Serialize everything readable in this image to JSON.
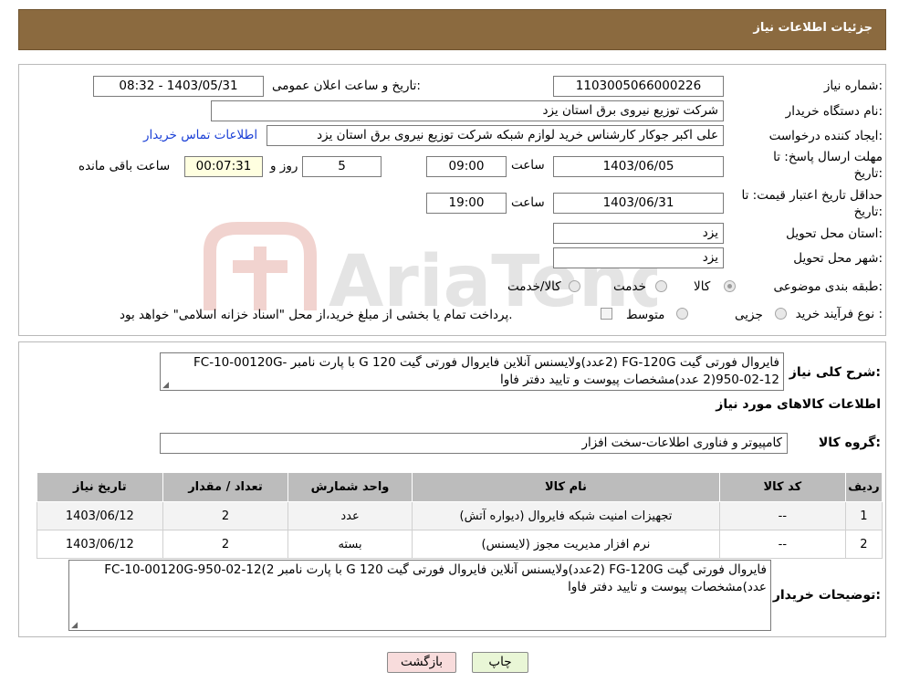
{
  "header": {
    "title": "جزئیات اطلاعات نیاز"
  },
  "form": {
    "need_number_label": "شماره نیاز:",
    "need_number": "1103005066000226",
    "announce_label": "تاریخ و ساعت اعلان عمومی:",
    "announce_value": "1403/05/31 - 08:32",
    "buyer_org_label": "نام دستگاه خریدار:",
    "buyer_org": "شرکت توزیع نیروی برق استان یزد",
    "requester_label": "ایجاد کننده درخواست:",
    "requester": "علی اکبر  جوکار  کارشناس خرید لوازم شبکه   شرکت توزیع نیروی برق استان یزد",
    "contact_link": "اطلاعات تماس خریدار",
    "deadline_label_1": "مهلت ارسال پاسخ: تا",
    "deadline_label_2": "تاریخ:",
    "deadline_date": "1403/06/05",
    "time_label": "ساعت",
    "deadline_time": "09:00",
    "days_value": "5",
    "days_label": "روز و",
    "remaining_time": "00:07:31",
    "remaining_label": "ساعت باقی مانده",
    "validity_label_1": "حداقل تاریخ اعتبار قیمت: تا",
    "validity_label_2": "تاریخ:",
    "validity_date": "1403/06/31",
    "validity_time": "19:00",
    "province_label": "استان محل تحویل:",
    "province": "یزد",
    "city_label": "شهر محل تحویل:",
    "city": "یزد",
    "category_label": "طبقه بندی موضوعی:",
    "category_options": [
      "کالا",
      "خدمت",
      "کالا/خدمت"
    ],
    "process_label": "نوع فرآیند خرید :",
    "process_options": [
      "جزیی",
      "متوسط"
    ],
    "payment_note": "پرداخت تمام یا بخشی از مبلغ خرید،از محل \"اسناد خزانه اسلامی\" خواهد بود."
  },
  "details": {
    "summary_label": "شرح کلی نیاز:",
    "summary_line1": "فایروال فورتی گیت FG-120G (2عدد)ولایسنس آنلاین فایروال فورتی گیت G 120 با پارت نامبر -FC-10-00120G",
    "summary_line2": "950-02-12(2 عدد)مشخصات پیوست و تایید دفتر فاوا",
    "goods_info_title": "اطلاعات کالاهای مورد نیاز",
    "goods_group_label": "گروه کالا:",
    "goods_group": "کامپیوتر و فناوری اطلاعات-سخت افزار"
  },
  "table": {
    "headers": [
      "ردیف",
      "کد کالا",
      "نام کالا",
      "واحد شمارش",
      "تعداد / مقدار",
      "تاریخ نیاز"
    ],
    "rows": [
      [
        "1",
        "--",
        "تجهیزات امنیت شبکه فایروال (دیواره آتش)",
        "عدد",
        "2",
        "1403/06/12"
      ],
      [
        "2",
        "--",
        "نرم افزار مدیریت مجوز (لایسنس)",
        "بسته",
        "2",
        "1403/06/12"
      ]
    ]
  },
  "buyer_notes": {
    "label": "توضیحات خریدار:",
    "line1": "فایروال فورتی گیت FG-120G (2عدد)ولایسنس آنلاین فایروال فورتی گیت G 120 با پارت نامبر FC-10-00120G-950-02-12(2",
    "line2": "عدد)مشخصات پیوست و تایید دفتر فاوا"
  },
  "buttons": {
    "print": "چاپ",
    "back": "بازگشت"
  },
  "colors": {
    "header": "#8b6a3f",
    "print_btn": "#e9f6d6",
    "back_btn": "#f8dcdc",
    "link": "#1a3fd6"
  }
}
